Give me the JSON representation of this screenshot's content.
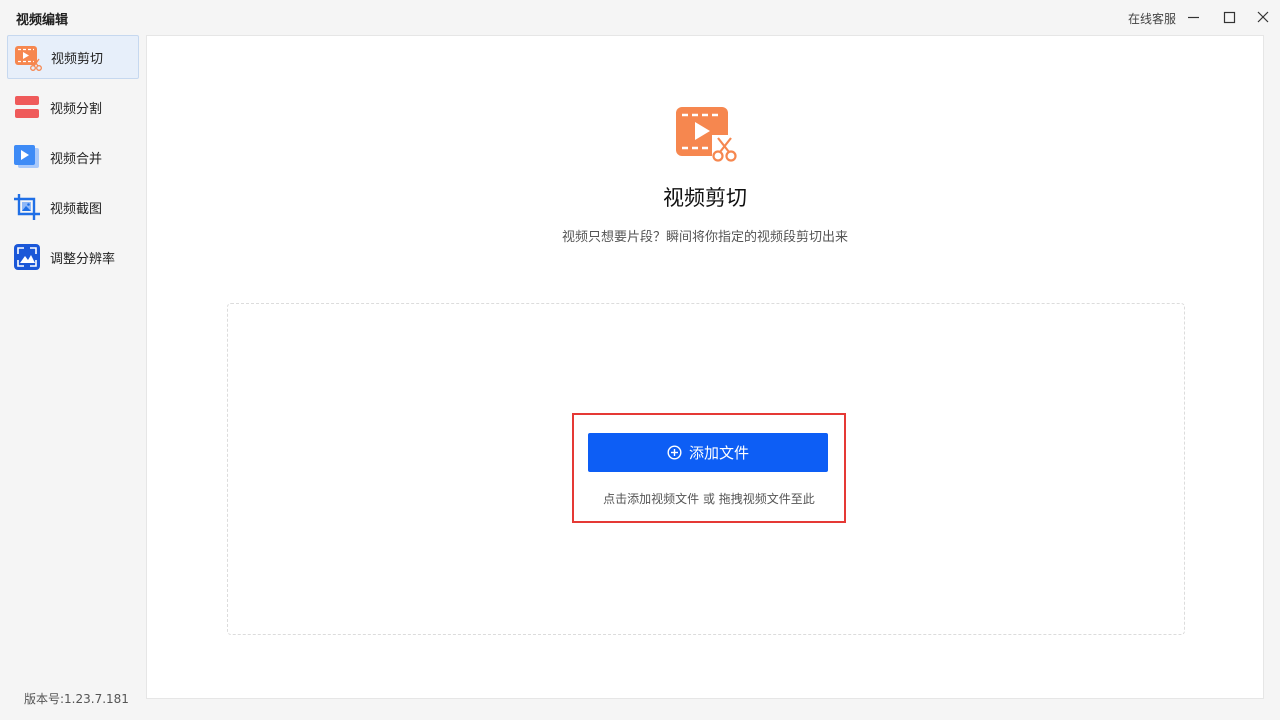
{
  "window": {
    "title": "视频编辑",
    "support_link": "在线客服"
  },
  "sidebar": {
    "items": [
      {
        "label": "视频剪切",
        "icon": "video-cut-icon",
        "active": true,
        "color": "#f6874f"
      },
      {
        "label": "视频分割",
        "icon": "video-split-icon",
        "active": false,
        "color": "#ef5a5a"
      },
      {
        "label": "视频合并",
        "icon": "video-merge-icon",
        "active": false,
        "color": "#3e8bf6"
      },
      {
        "label": "视频截图",
        "icon": "video-screenshot-icon",
        "active": false,
        "color": "#1f6fe6"
      },
      {
        "label": "调整分辨率",
        "icon": "resolution-icon",
        "active": false,
        "color": "#1a57d8"
      }
    ],
    "version": "版本号:1.23.7.181"
  },
  "main": {
    "title": "视频剪切",
    "subtitle": "视频只想要片段？瞬间将你指定的视频段剪切出来",
    "add_button_label": "添加文件",
    "drop_hint": "点击添加视频文件 或 拖拽视频文件至此"
  },
  "colors": {
    "accent": "#0d5ef5",
    "highlight": "#e53935",
    "cut_icon": "#f6874f"
  }
}
